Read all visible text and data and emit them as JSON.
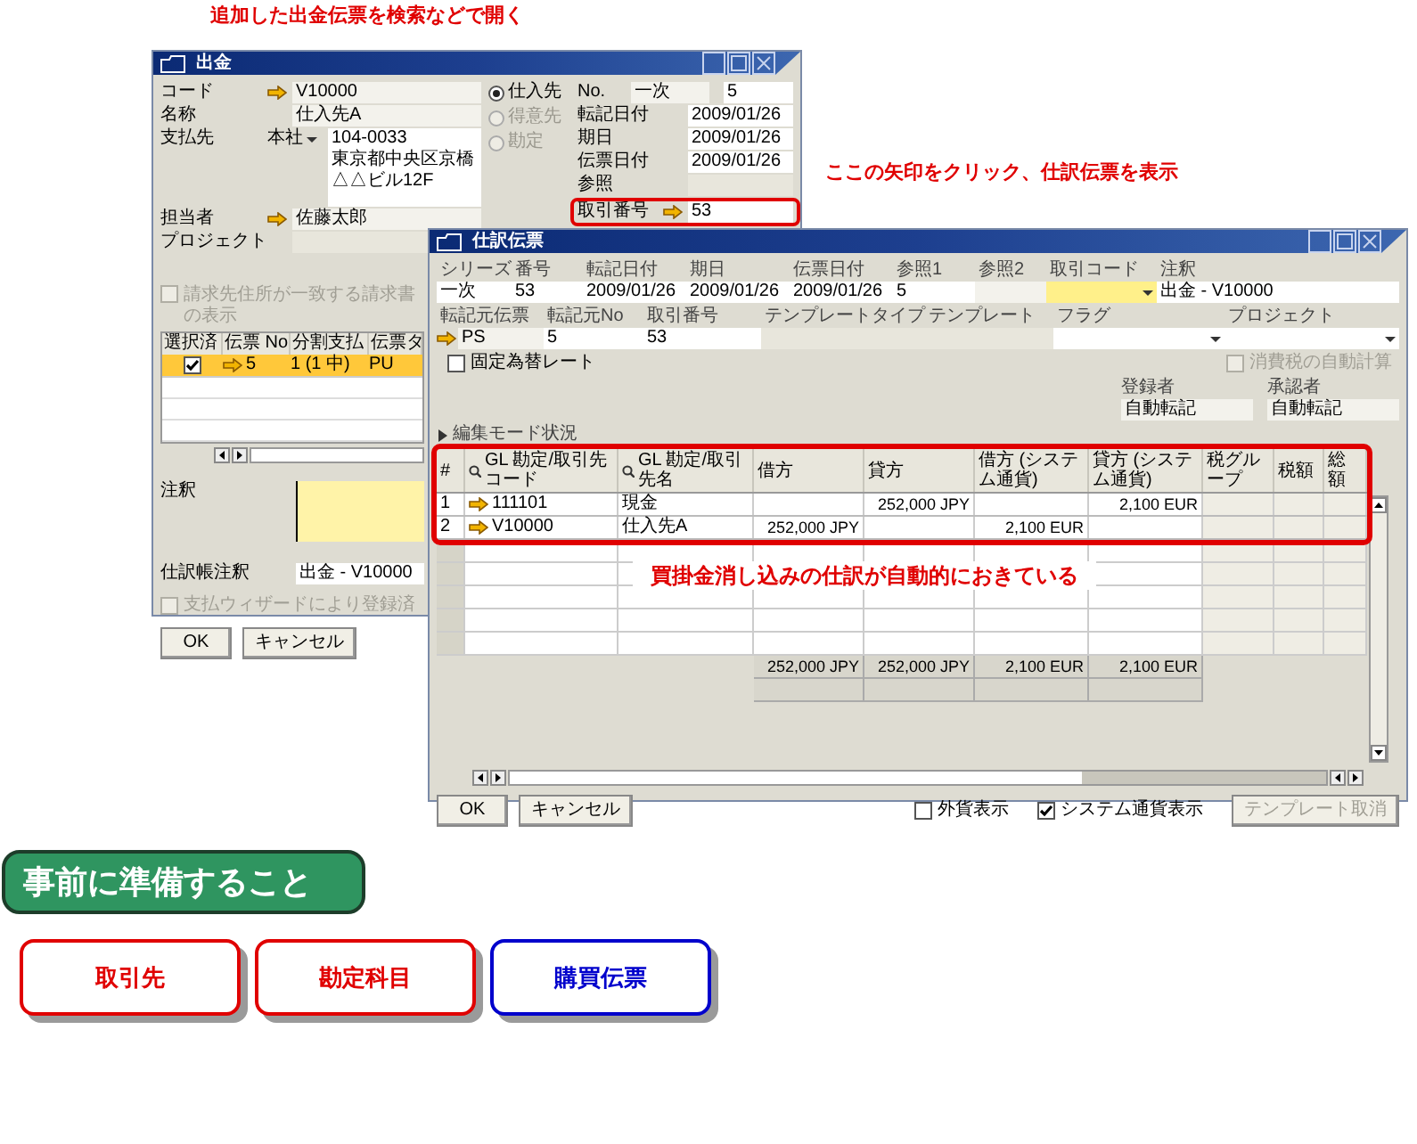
{
  "top_caption": "追加した出金伝票を検索などで開く",
  "side_caption": "ここの矢印をクリック、仕訳伝票を表示",
  "payment_window": {
    "title": "出金",
    "left_fields": [
      {
        "kind": "text",
        "label": "コード",
        "value": "V10000",
        "link": true
      },
      {
        "kind": "text",
        "label": "名称",
        "value": "仕入先A",
        "link": false
      },
      {
        "kind": "address",
        "label": "支払先",
        "choice": "本社",
        "lines": [
          "104-0033",
          "東京都中央区京橋",
          "△△ビル12F"
        ]
      },
      {
        "kind": "text",
        "label": "担当者",
        "value": "佐藤太郎",
        "link": true
      },
      {
        "kind": "empty",
        "label": "プロジェクト"
      }
    ],
    "partner_types": [
      {
        "label": "仕入先",
        "selected": true,
        "disabled": false
      },
      {
        "label": "得意先",
        "selected": false,
        "disabled": true
      },
      {
        "label": "勘定",
        "selected": false,
        "disabled": true
      }
    ],
    "number": {
      "label": "No.",
      "series": "一次",
      "value": "5"
    },
    "doc_fields": [
      {
        "label": "転記日付",
        "value": "2009/01/26",
        "link": false,
        "highlighted": false
      },
      {
        "label": "期日",
        "value": "2009/01/26",
        "link": false,
        "highlighted": false
      },
      {
        "label": "伝票日付",
        "value": "2009/01/26",
        "link": false,
        "highlighted": false
      },
      {
        "label": "参照",
        "link": false,
        "highlighted": false
      },
      {
        "label": "取引番号",
        "value": "53",
        "link": true,
        "highlighted": true
      }
    ],
    "invoice_filter": {
      "label": "請求先住所が一致する請求書の表示",
      "checked": false,
      "disabled": true
    },
    "invoice_table": {
      "columns": [
        "選択済",
        "伝票 No",
        "分割支払",
        "伝票タ"
      ],
      "rows": [
        {
          "checked": true,
          "selected": true,
          "number": "5",
          "split": "1 (1 中)",
          "type": "PU"
        }
      ]
    },
    "remarks": {
      "label": "注釈"
    },
    "journal_remarks": {
      "label": "仕訳帳注釈",
      "value": "出金 - V10000"
    },
    "wizard": {
      "label": "支払ウィザードにより登録済",
      "checked": false,
      "disabled": true
    },
    "buttons": [
      "OK",
      "キャンセル"
    ]
  },
  "journal_window": {
    "title": "仕訳伝票",
    "row1": [
      {
        "kind": "text",
        "label": "シリーズ",
        "value": "一次"
      },
      {
        "kind": "text",
        "label": "番号",
        "value": "53"
      },
      {
        "kind": "text",
        "label": "転記日付",
        "value": "2009/01/26"
      },
      {
        "kind": "text",
        "label": "期日",
        "value": "2009/01/26"
      },
      {
        "kind": "text",
        "label": "伝票日付",
        "value": "2009/01/26"
      },
      {
        "kind": "text",
        "label": "参照1",
        "value": "5"
      },
      {
        "kind": "text",
        "label": "参照2"
      },
      {
        "kind": "dropdown",
        "label": "取引コード",
        "focused": true
      },
      {
        "kind": "text",
        "label": "注釈",
        "value": "出金 - V10000"
      }
    ],
    "row2": [
      {
        "kind": "link",
        "label": "転記元伝票",
        "value": "PS"
      },
      {
        "kind": "text",
        "label": "転記元No",
        "value": "5"
      },
      {
        "kind": "text",
        "label": "取引番号",
        "value": "53"
      },
      {
        "kind": "readonly",
        "label": "テンプレートタイプ"
      },
      {
        "kind": "readonly",
        "label": "テンプレート"
      },
      {
        "kind": "dropdown",
        "label": "フラグ",
        "focused": false
      },
      {
        "kind": "dropdown",
        "label": "プロジェクト",
        "focused": false
      }
    ],
    "fixed_rate": {
      "label": "固定為替レート",
      "checked": false,
      "disabled": false
    },
    "auto_tax": {
      "label": "消費税の自動計算",
      "checked": false,
      "disabled": true
    },
    "approvals": [
      {
        "label": "登録者",
        "value": "自動転記"
      },
      {
        "label": "承認者",
        "value": "自動転記"
      }
    ],
    "edit_mode": {
      "label": "編集モード状況",
      "expanded": false
    },
    "table": {
      "highlighted": true,
      "columns": [
        "#",
        "GL 勘定/取引先コード",
        "GL 勘定/取引先名",
        "借方",
        "貸方",
        "借方 (システム通貨)",
        "貸方 (システム通貨)",
        "税グループ",
        "税額",
        "総額"
      ],
      "rows": [
        {
          "cells": [
            "1",
            "111101",
            "現金",
            "",
            "252,000 JPY",
            "",
            "2,100 EUR",
            "",
            "",
            ""
          ]
        },
        {
          "cells": [
            "2",
            "V10000",
            "仕入先A",
            "252,000 JPY",
            "",
            "2,100 EUR",
            "",
            "",
            "",
            ""
          ]
        }
      ],
      "caption": "買掛金消し込みの仕訳が自動的におきている",
      "totals": [
        "252,000 JPY",
        "252,000 JPY",
        "2,100 EUR",
        "2,100 EUR"
      ]
    },
    "buttons": [
      "OK",
      "キャンセル"
    ],
    "options": [
      {
        "label": "外貨表示",
        "checked": false
      },
      {
        "label": "システム通貨表示",
        "checked": true
      }
    ],
    "template_cancel": {
      "label": "テンプレート取消",
      "disabled": true
    }
  },
  "prep_heading": "事前に準備すること",
  "prep_items": [
    {
      "label": "取引先",
      "color": "#e00000"
    },
    {
      "label": "勘定科目",
      "color": "#e00000"
    },
    {
      "label": "購買伝票",
      "color": "#0000cc"
    }
  ]
}
